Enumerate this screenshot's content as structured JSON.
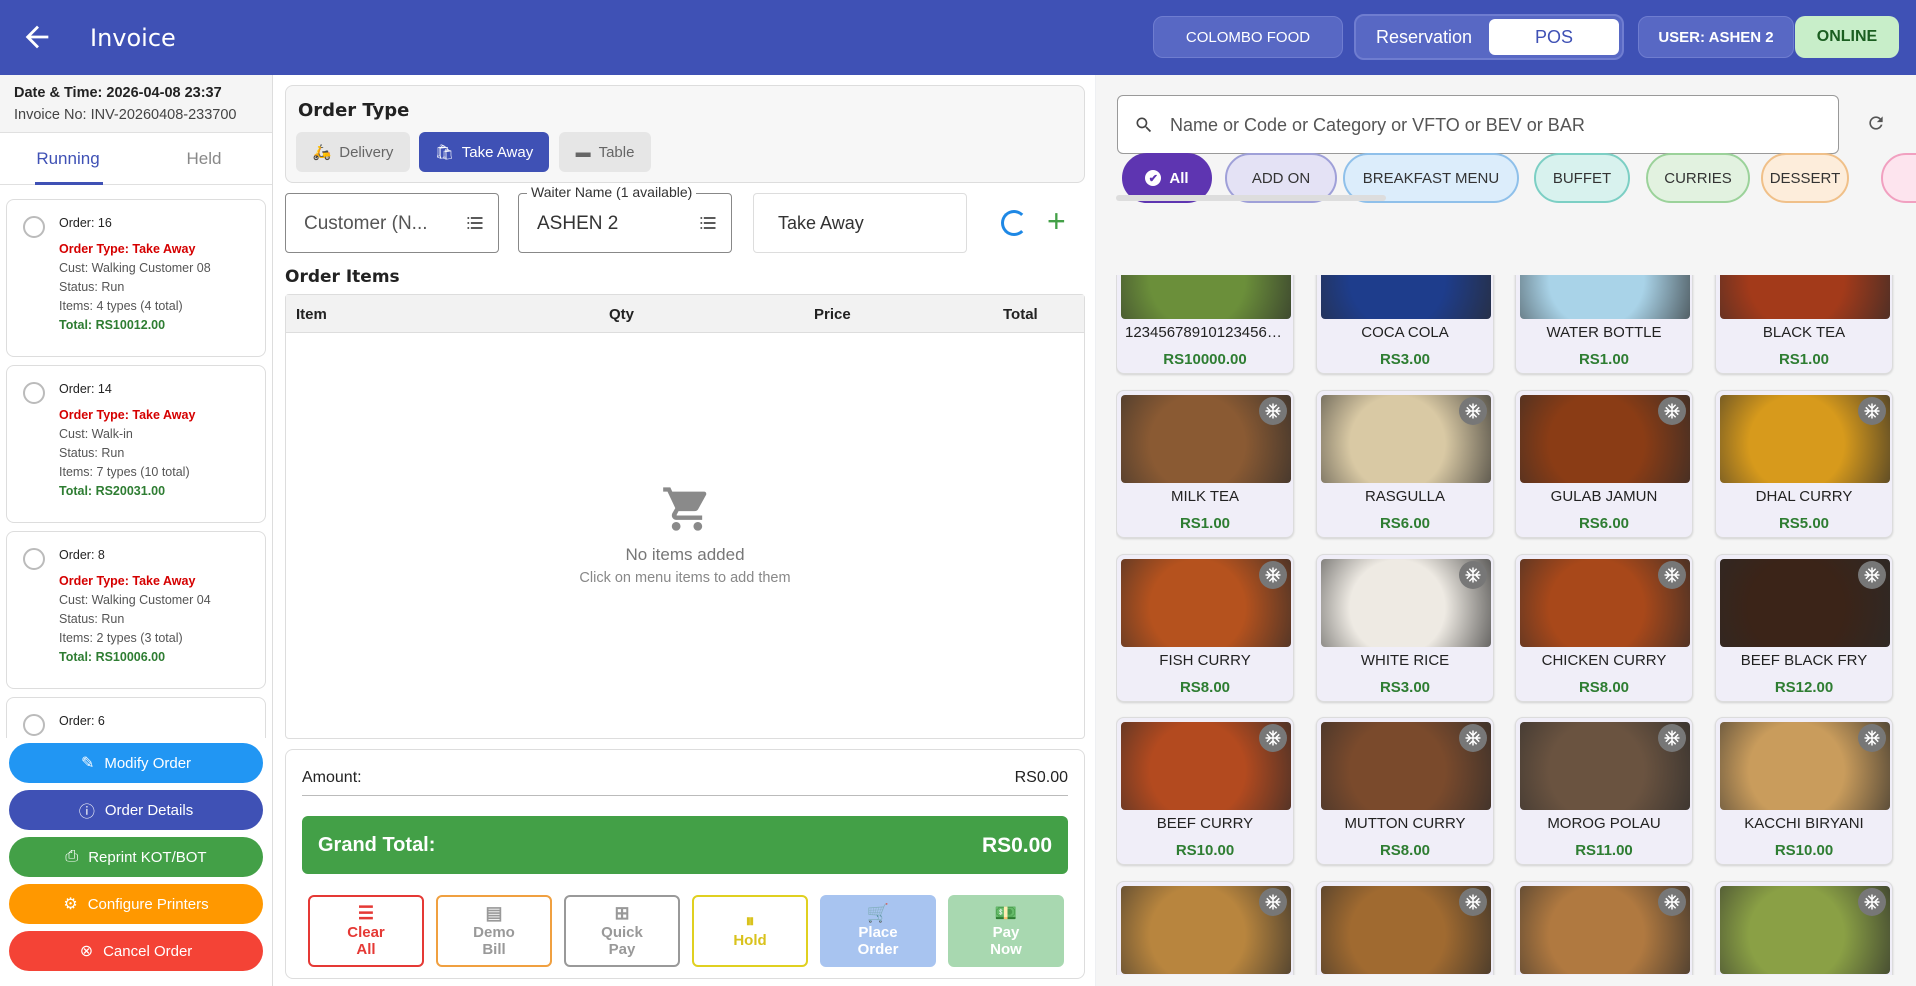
{
  "header": {
    "title": "Invoice",
    "restaurant": "COLOMBO FOOD",
    "modes": [
      "Reservation",
      "POS"
    ],
    "active_mode": "POS",
    "user": "USER: ASHEN 2",
    "status": "ONLINE"
  },
  "sidebar": {
    "datetime": "Date & Time: 2026-04-08 23:37",
    "invoice_no": "Invoice No: INV-20260408-233700",
    "tabs": [
      "Running",
      "Held"
    ],
    "orders": [
      {
        "num": "Order: 16",
        "type": "Order Type: Take Away",
        "cust": "Cust: Walking Customer 08",
        "status": "Status: Run",
        "items": "Items: 4 types (4 total)",
        "total": "Total: RS10012.00"
      },
      {
        "num": "Order: 14",
        "type": "Order Type: Take Away",
        "cust": "Cust: Walk-in",
        "status": "Status: Run",
        "items": "Items: 7 types (10 total)",
        "total": "Total: RS20031.00"
      },
      {
        "num": "Order: 8",
        "type": "Order Type: Take Away",
        "cust": "Cust: Walking Customer 04",
        "status": "Status: Run",
        "items": "Items: 2 types (3 total)",
        "total": "Total: RS10006.00"
      },
      {
        "num": "Order: 6",
        "type": "",
        "cust": "",
        "status": "",
        "items": "",
        "total": ""
      }
    ],
    "actions": {
      "modify": "Modify Order",
      "details": "Order Details",
      "reprint": "Reprint KOT/BOT",
      "config": "Configure Printers",
      "cancel": "Cancel Order"
    }
  },
  "order": {
    "type_title": "Order Type",
    "types": {
      "delivery": "Delivery",
      "takeaway": "Take Away",
      "table": "Table"
    },
    "customer_value": "Customer (N...",
    "waiter_legend": "Waiter Name (1 available)",
    "waiter_value": "ASHEN 2",
    "mode_value": "Take Away",
    "items_title": "Order Items",
    "columns": {
      "item": "Item",
      "qty": "Qty",
      "price": "Price",
      "total": "Total"
    },
    "empty_title": "No items added",
    "empty_sub": "Click on menu items to add them",
    "amount_label": "Amount:",
    "amount_value": "RS0.00",
    "grand_label": "Grand Total:",
    "grand_value": "RS0.00",
    "buttons": {
      "clear": [
        "Clear",
        "All"
      ],
      "demo": [
        "Demo",
        "Bill"
      ],
      "quick": [
        "Quick",
        "Pay"
      ],
      "hold": "Hold",
      "place": [
        "Place",
        "Order"
      ],
      "pay": [
        "Pay",
        "Now"
      ]
    }
  },
  "menu": {
    "search_placeholder": "Name or Code or Category or VFTO or BEV or BAR",
    "categories": [
      {
        "label": "All",
        "bg": "#5e35b1",
        "fg": "#ffffff",
        "border": "#5e35b1"
      },
      {
        "label": "ADD ON",
        "bg": "#e4e2f5",
        "fg": "#333333",
        "border": "#9fa0d8"
      },
      {
        "label": "BREAKFAST MENU",
        "bg": "#dcedfb",
        "fg": "#333333",
        "border": "#8fc0ea"
      },
      {
        "label": "BUFFET",
        "bg": "#d8f2ee",
        "fg": "#333333",
        "border": "#7ccfc4"
      },
      {
        "label": "CURRIES",
        "bg": "#e2f2e0",
        "fg": "#333333",
        "border": "#9bd29a"
      },
      {
        "label": "DESSERT",
        "bg": "#fdeddb",
        "fg": "#333333",
        "border": "#f0c089"
      },
      {
        "label": "",
        "bg": "#fde4ee",
        "fg": "#333333",
        "border": "#f1a0c0"
      }
    ],
    "items": [
      {
        "name": "123456789101234567...",
        "price": "RS10000.00",
        "color": "#6b8f3a"
      },
      {
        "name": "COCA COLA",
        "price": "RS3.00",
        "color": "#1e3d8c"
      },
      {
        "name": "WATER BOTTLE",
        "price": "RS1.00",
        "color": "#a9d3e8"
      },
      {
        "name": "BLACK TEA",
        "price": "RS1.00",
        "color": "#a33a1a"
      },
      {
        "name": "MILK TEA",
        "price": "RS1.00",
        "color": "#8a5a33"
      },
      {
        "name": "RASGULLA",
        "price": "RS6.00",
        "color": "#d9c9a4"
      },
      {
        "name": "GULAB JAMUN",
        "price": "RS6.00",
        "color": "#8a3c15"
      },
      {
        "name": "DHAL CURRY",
        "price": "RS5.00",
        "color": "#d79a1c"
      },
      {
        "name": "FISH CURRY",
        "price": "RS8.00",
        "color": "#b5521e"
      },
      {
        "name": "WHITE RICE",
        "price": "RS3.00",
        "color": "#eeeae3"
      },
      {
        "name": "CHICKEN CURRY",
        "price": "RS8.00",
        "color": "#a8481a"
      },
      {
        "name": "BEEF BLACK FRY",
        "price": "RS12.00",
        "color": "#3b2418"
      },
      {
        "name": "BEEF CURRY",
        "price": "RS10.00",
        "color": "#b34a1f"
      },
      {
        "name": "MUTTON CURRY",
        "price": "RS8.00",
        "color": "#7a4a2c"
      },
      {
        "name": "MOROG POLAU",
        "price": "RS11.00",
        "color": "#6a5340"
      },
      {
        "name": "KACCHI BIRYANI",
        "price": "RS10.00",
        "color": "#c99c5c"
      },
      {
        "name": "",
        "price": "",
        "color": "#b8853e"
      },
      {
        "name": "",
        "price": "",
        "color": "#a06a30"
      },
      {
        "name": "",
        "price": "",
        "color": "#b07940"
      },
      {
        "name": "",
        "price": "",
        "color": "#8aa045"
      }
    ]
  }
}
